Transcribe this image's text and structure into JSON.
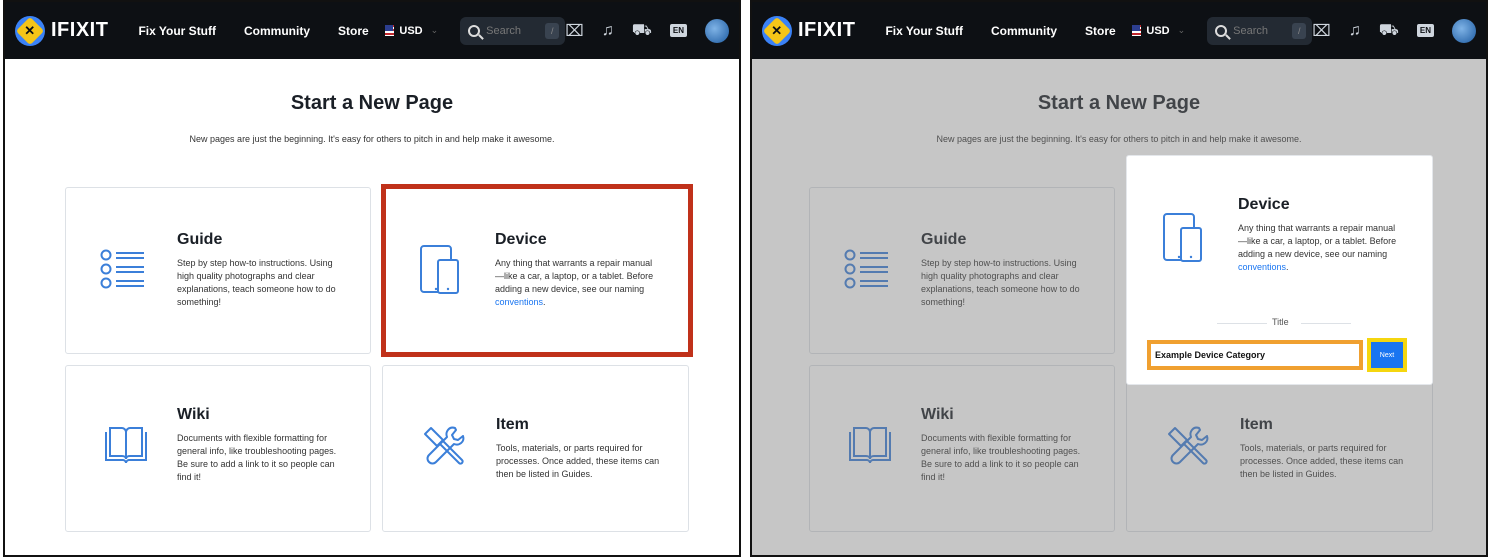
{
  "nav": {
    "logo": "IFIXIT",
    "links": [
      "Fix Your Stuff",
      "Community",
      "Store"
    ],
    "currency": "USD",
    "search_placeholder": "Search",
    "search_shortcut": "/",
    "language": "EN"
  },
  "page": {
    "title": "Start a New Page",
    "subtitle": "New pages are just the beginning. It's easy for others to pitch in and help make it awesome."
  },
  "cards": {
    "guide": {
      "title": "Guide",
      "desc": "Step by step how-to instructions. Using high quality photographs and clear explanations, teach someone how to do something!"
    },
    "device": {
      "title": "Device",
      "desc": "Any thing that warrants a repair manual—like a car, a laptop, or a tablet. Before adding a new device, see our naming ",
      "link": "conventions",
      "period": "."
    },
    "wiki": {
      "title": "Wiki",
      "desc": "Documents with flexible formatting for general info, like troubleshooting pages. Be sure to add a link to it so people can find it!"
    },
    "item": {
      "title": "Item",
      "desc": "Tools, materials, or parts required for processes. Once added, these items can then be listed in Guides."
    }
  },
  "device_form": {
    "title_label": "Title",
    "title_value": "Example Device Category",
    "next_label": "Next"
  },
  "colors": {
    "accent": "#1975f1",
    "highlight_red": "#c0311a",
    "highlight_orange": "#f0a030",
    "highlight_yellow": "#f5d60f"
  },
  "icons": [
    "list-icon",
    "tablet-icon",
    "book-icon",
    "tools-icon",
    "search-icon",
    "toolbox-icon",
    "bell-icon",
    "cart-icon",
    "avatar"
  ]
}
